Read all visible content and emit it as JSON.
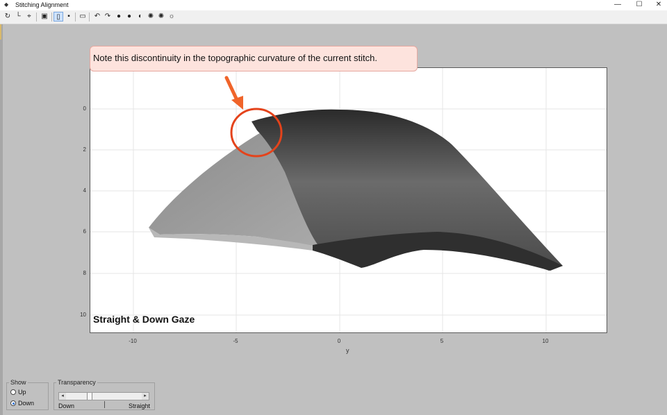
{
  "window": {
    "title": "Stitching Alignment",
    "controls": [
      "—",
      "☐",
      "✕"
    ]
  },
  "toolbar": {
    "icons": [
      "rotate-icon",
      "axes-icon",
      "data-cursor-icon",
      "save-icon",
      "panel-on-icon",
      "palette-icon",
      "layout-icon",
      "undo-icon",
      "redo-icon",
      "brightness-icon-1",
      "brightness-icon-2",
      "brightness-icon-3",
      "sun-icon-1",
      "sun-icon-2",
      "sun-icon-3"
    ]
  },
  "annotation": {
    "note": "Note this discontinuity in the topographic curvature of the current stitch.",
    "arrow_color": "#f0642a",
    "circle_color": "#e4431b"
  },
  "plot": {
    "label": "Straight & Down Gaze",
    "xlabel": "y",
    "xticks": [
      "-10",
      "-5",
      "0",
      "5",
      "10"
    ],
    "yticks": [
      "0",
      "2",
      "4",
      "6",
      "8",
      "10"
    ]
  },
  "show_group": {
    "title": "Show",
    "options": [
      "Up",
      "Down"
    ],
    "selected": "Down"
  },
  "transparency_group": {
    "title": "Transparency",
    "left_label": "Down",
    "right_label": "Straight",
    "value": 0.3
  }
}
